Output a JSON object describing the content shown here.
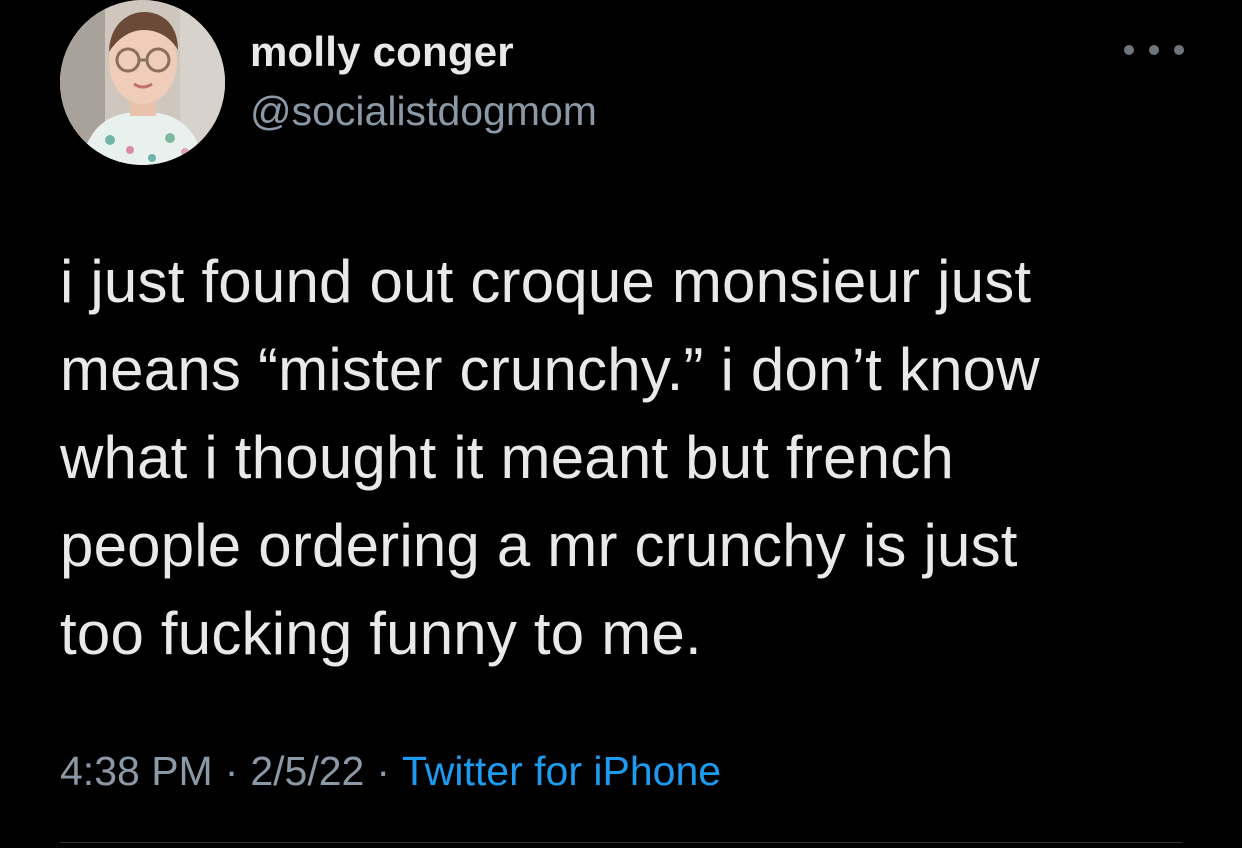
{
  "author": {
    "name": "molly conger",
    "handle": "@socialistdogmom",
    "avatar_icon": "user-avatar-photo"
  },
  "more_icon": "more-options-icon",
  "tweet": {
    "lines": [
      "i just found out croque monsieur just",
      "means “mister crunchy.” i don’t know",
      "what i thought it meant but french",
      "people ordering a mr crunchy is just",
      "too fucking funny to me."
    ]
  },
  "meta": {
    "time": "4:38 PM",
    "separator": "·",
    "date": "2/5/22",
    "source": "Twitter for iPhone"
  },
  "colors": {
    "background": "#000000",
    "text_primary": "#e7e9ea",
    "text_secondary": "#8b98a5",
    "link": "#1d9bf0"
  }
}
